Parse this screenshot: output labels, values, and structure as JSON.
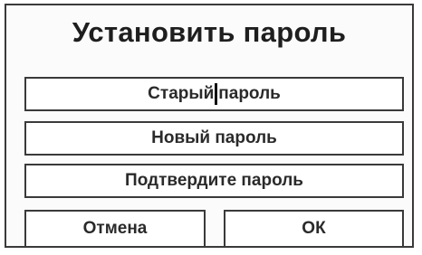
{
  "dialog": {
    "title": "Установить пароль",
    "fields": {
      "old_password": {
        "text_before_cursor": "Старый",
        "text_after_cursor": "пароль"
      },
      "new_password": {
        "placeholder": "Новый пароль"
      },
      "confirm_password": {
        "placeholder": "Подтвердите пароль"
      }
    },
    "buttons": {
      "cancel_label": "Отмена",
      "ok_label": "ОК"
    }
  }
}
